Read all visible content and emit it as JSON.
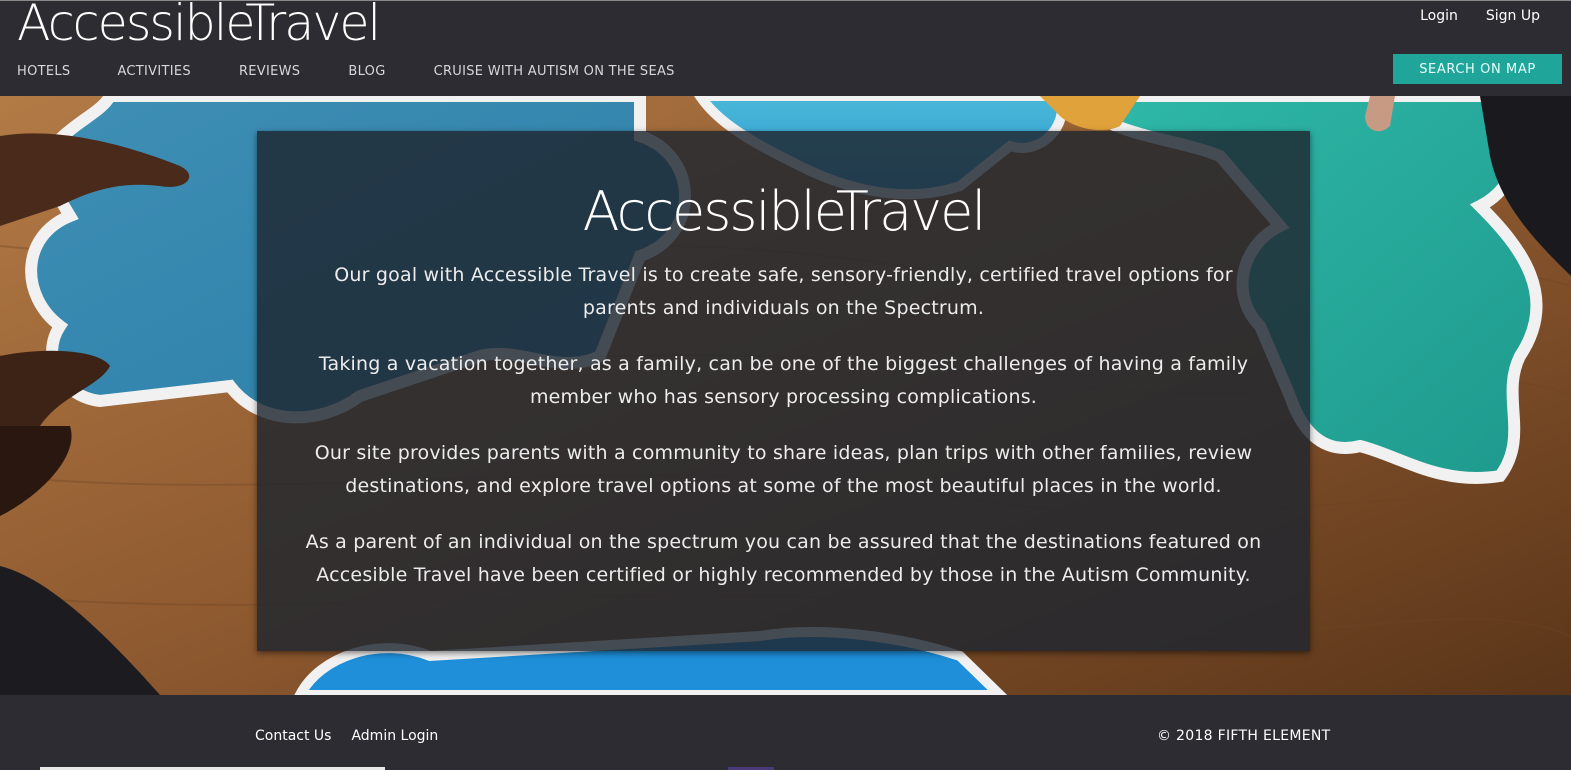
{
  "header": {
    "brand": "AccessibleTravel",
    "auth": {
      "login_label": "Login",
      "signup_label": "Sign Up"
    },
    "nav": [
      {
        "label": "HOTELS"
      },
      {
        "label": "ACTIVITIES"
      },
      {
        "label": "REVIEWS"
      },
      {
        "label": "BLOG"
      },
      {
        "label": "CRUISE WITH AUTISM ON THE SEAS"
      }
    ],
    "map_button_label": "SEARCH ON MAP"
  },
  "hero": {
    "title": "AccessibleTravel",
    "paragraphs": [
      "Our goal with Accessible Travel is to create safe, sensory-friendly, certified travel options for parents and individuals on the Spectrum.",
      "Taking a vacation together, as a family, can be one of the biggest challenges of having a family member who has sensory processing complications.",
      "Our site provides parents with a community to share ideas, plan trips with other families, review destinations, and explore travel options at some of the most beautiful places in the world.",
      "As a parent of an individual on the spectrum you can be assured that the destinations featured on Accesible Travel have been certified or highly recommended by those in the Autism Community."
    ]
  },
  "footer": {
    "contact_label": "Contact Us",
    "admin_label": "Admin Login",
    "copyright": "© 2018 FIFTH ELEMENT"
  },
  "colors": {
    "header_bg": "#2d2c32",
    "accent": "#1fa59a",
    "card_bg": "rgba(30,38,48,0.82)"
  }
}
